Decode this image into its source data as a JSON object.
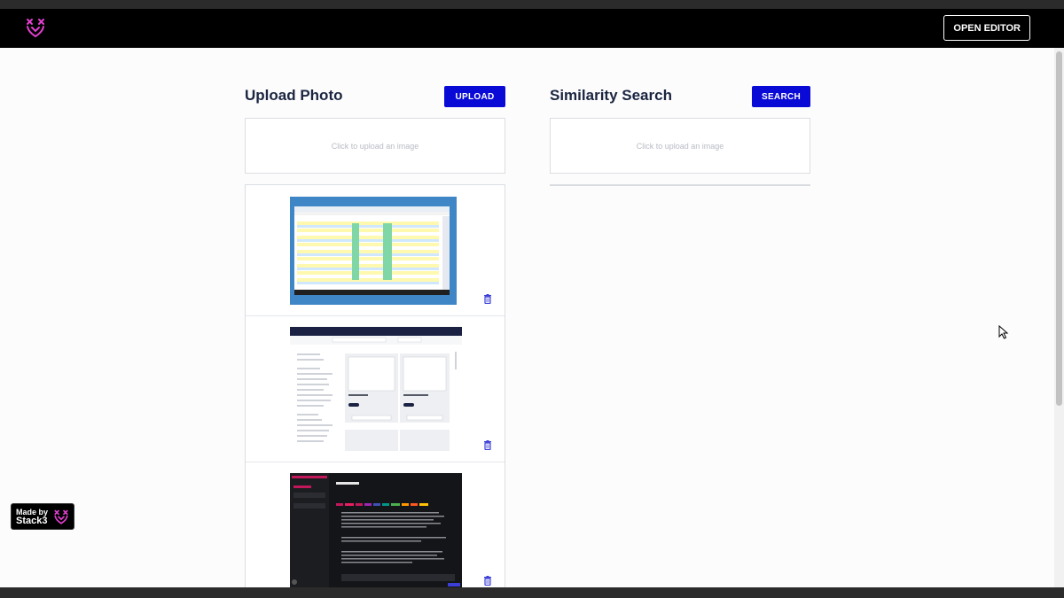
{
  "header": {
    "open_editor_label": "OPEN EDITOR"
  },
  "upload": {
    "title": "Upload Photo",
    "button_label": "UPLOAD",
    "dropzone_text": "Click to upload an image"
  },
  "search": {
    "title": "Similarity Search",
    "button_label": "SEARCH",
    "dropzone_text": "Click to upload an image"
  },
  "images": [
    {
      "name": "spreadsheet-screenshot",
      "icon": "trash-icon"
    },
    {
      "name": "product-catalog-screenshot",
      "icon": "trash-icon"
    },
    {
      "name": "dark-chat-screenshot",
      "icon": "trash-icon"
    }
  ],
  "badge": {
    "line1": "Made by",
    "line2": "Stack3"
  },
  "colors": {
    "accent": "#0a0ad6",
    "navbar": "#000000",
    "logo": "#e23fd0",
    "title": "#1b2540"
  }
}
